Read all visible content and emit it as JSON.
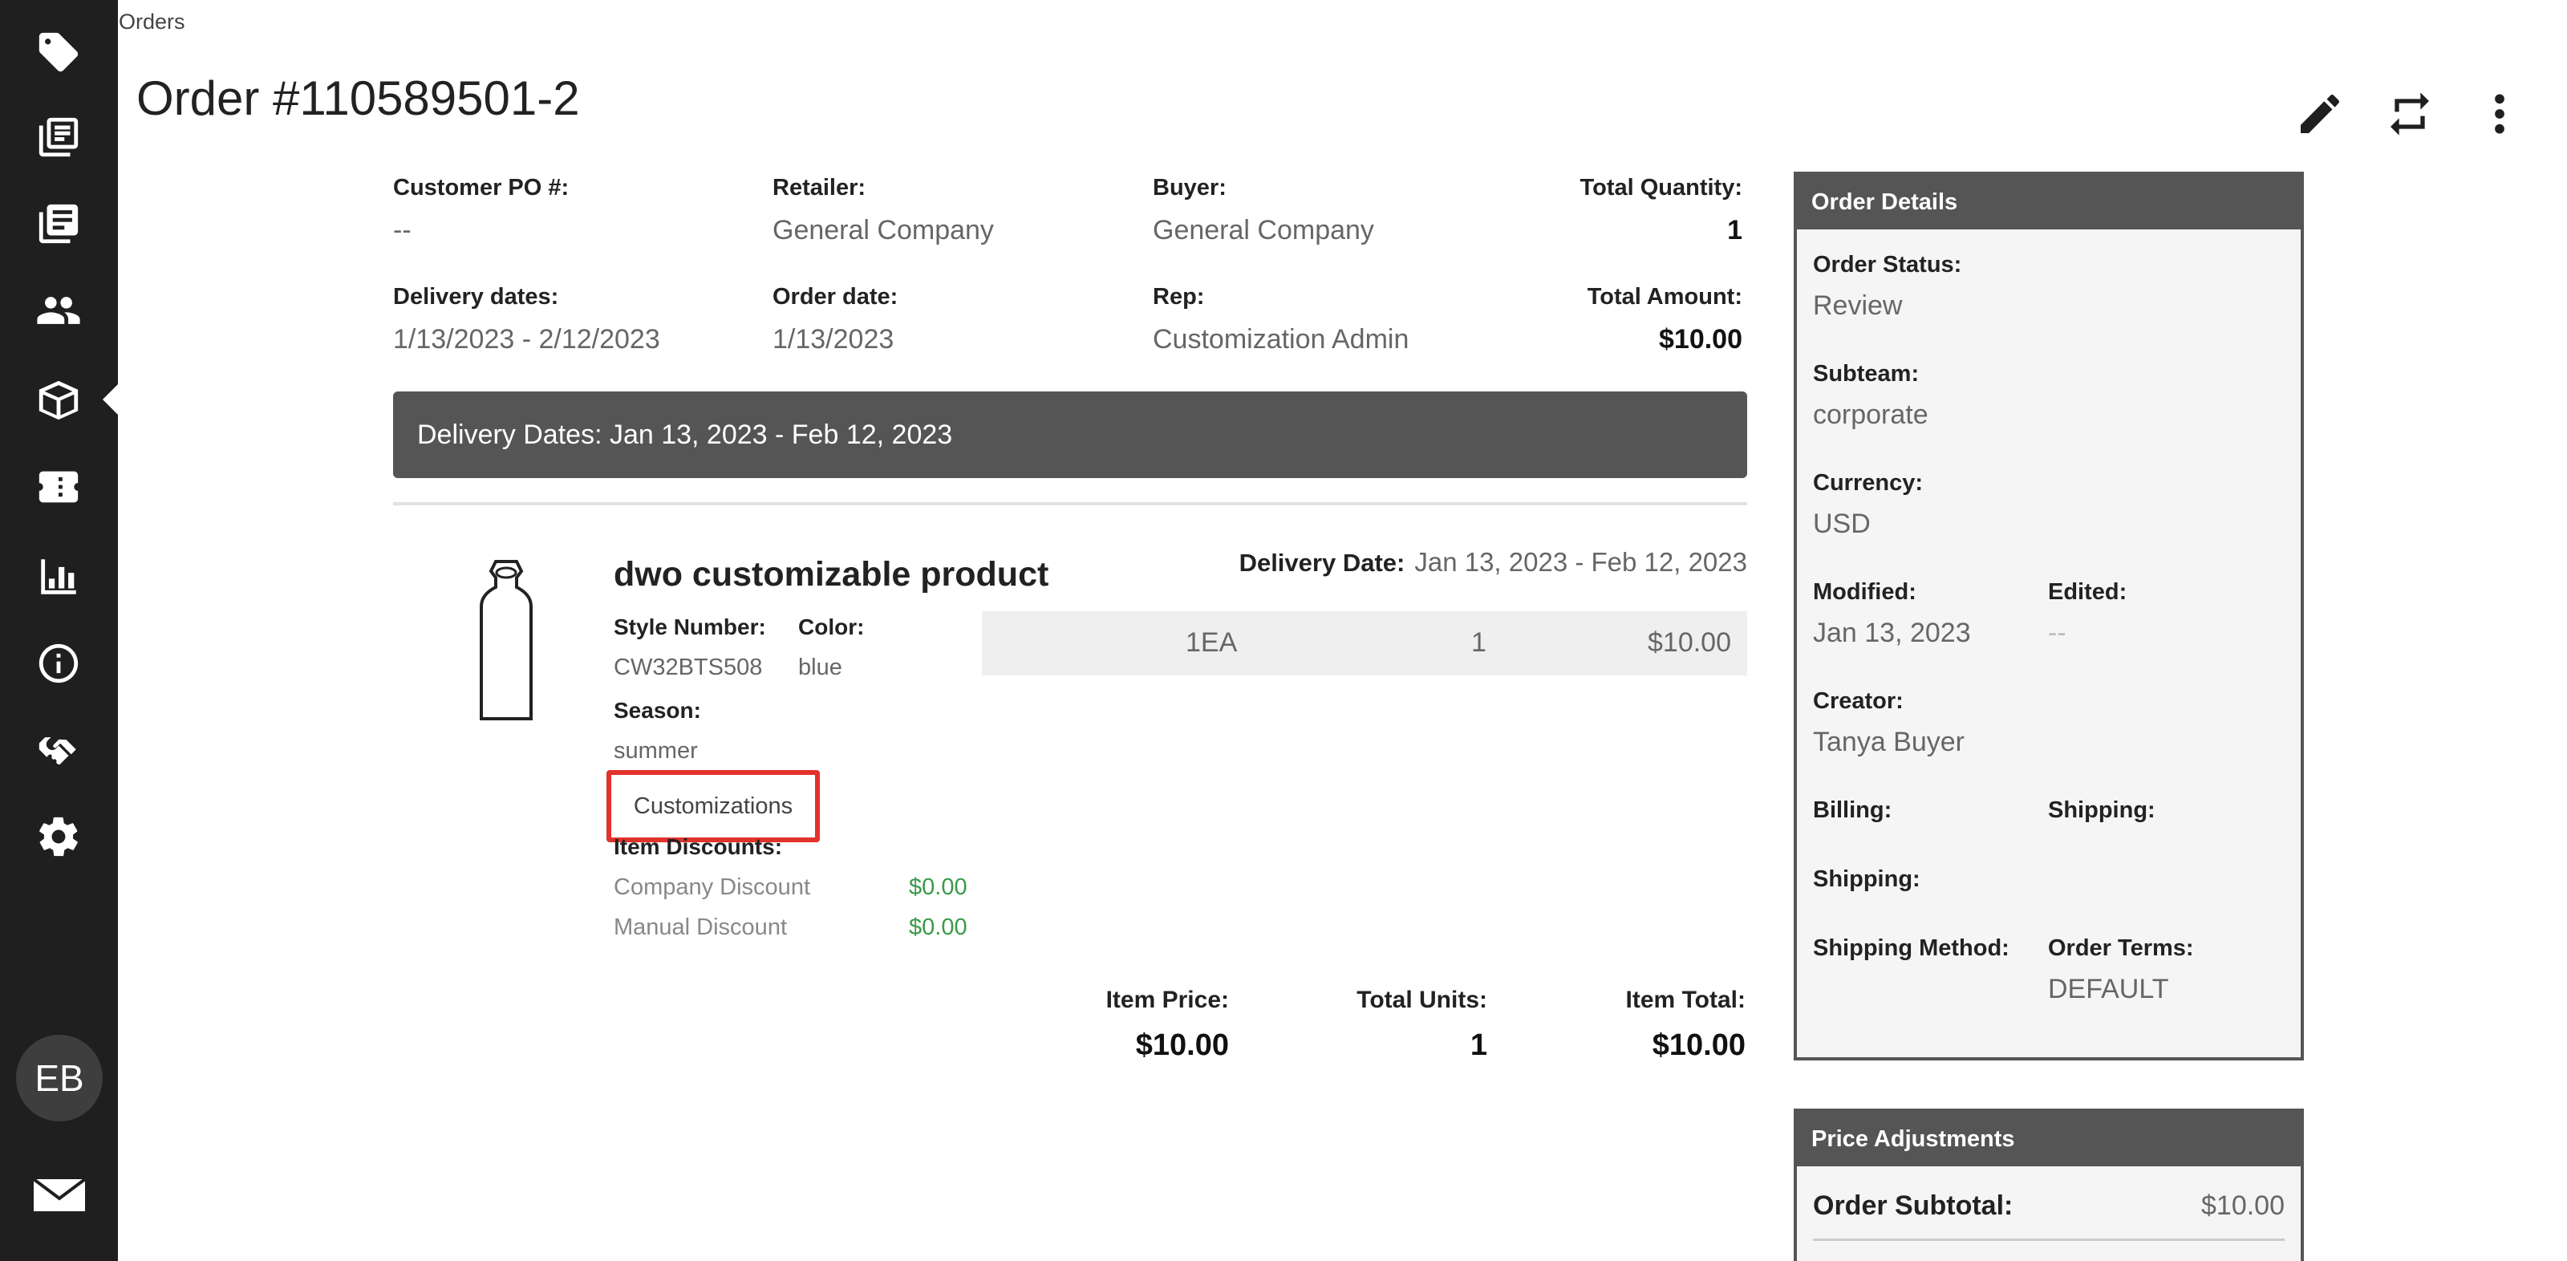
{
  "sidebar": {
    "items": [
      {
        "name": "tag",
        "icon": "tag-icon"
      },
      {
        "name": "catalog",
        "icon": "catalog-icon"
      },
      {
        "name": "linesheets",
        "icon": "linesheet-icon"
      },
      {
        "name": "customers",
        "icon": "users-icon"
      },
      {
        "name": "orders",
        "icon": "box-icon",
        "active": true
      },
      {
        "name": "promotions",
        "icon": "promotion-icon"
      },
      {
        "name": "reports",
        "icon": "chart-icon"
      },
      {
        "name": "info",
        "icon": "info-icon"
      },
      {
        "name": "partners",
        "icon": "handshake-icon"
      },
      {
        "name": "settings",
        "icon": "gear-icon"
      }
    ],
    "avatar_initials": "EB"
  },
  "header": {
    "breadcrumb": "Orders",
    "title": "Order #110589501-2"
  },
  "summary": {
    "customer_po_label": "Customer PO #:",
    "customer_po_value": "--",
    "retailer_label": "Retailer:",
    "retailer_value": "General Company",
    "buyer_label": "Buyer:",
    "buyer_value": "General Company",
    "total_qty_label": "Total Quantity:",
    "total_qty_value": "1",
    "delivery_dates_label": "Delivery dates:",
    "delivery_dates_value": "1/13/2023 - 2/12/2023",
    "order_date_label": "Order date:",
    "order_date_value": "1/13/2023",
    "rep_label": "Rep:",
    "rep_value": "Customization Admin",
    "total_amount_label": "Total Amount:",
    "total_amount_value": "$10.00"
  },
  "delivery_band": "Delivery Dates: Jan 13, 2023 - Feb 12, 2023",
  "item": {
    "name": "dwo customizable product",
    "style_label": "Style Number:",
    "style_value": "CW32BTS508",
    "color_label": "Color:",
    "color_value": "blue",
    "season_label": "Season:",
    "season_value": "summer",
    "delivery_label": "Delivery Date:",
    "delivery_value": "Jan 13, 2023 - Feb 12, 2023",
    "unit": "1EA",
    "qty": "1",
    "price": "$10.00",
    "customizations_button": "Customizations",
    "discounts_label": "Item Discounts:",
    "company_discount_label": "Company Discount",
    "company_discount_value": "$0.00",
    "manual_discount_label": "Manual Discount",
    "manual_discount_value": "$0.00",
    "item_price_label": "Item Price:",
    "item_price_value": "$10.00",
    "total_units_label": "Total Units:",
    "total_units_value": "1",
    "item_total_label": "Item Total:",
    "item_total_value": "$10.00"
  },
  "order_details": {
    "title": "Order Details",
    "status_label": "Order Status:",
    "status_value": "Review",
    "subteam_label": "Subteam:",
    "subteam_value": "corporate",
    "currency_label": "Currency:",
    "currency_value": "USD",
    "modified_label": "Modified:",
    "modified_value": "Jan 13, 2023",
    "edited_label": "Edited:",
    "edited_value": "--",
    "creator_label": "Creator:",
    "creator_value": "Tanya Buyer",
    "billing_label": "Billing:",
    "shipping_label": "Shipping:",
    "shipping2_label": "Shipping:",
    "shipping_method_label": "Shipping Method:",
    "order_terms_label": "Order Terms:",
    "order_terms_value": "DEFAULT"
  },
  "price_adjustments": {
    "title": "Price Adjustments",
    "subtotal_label": "Order Subtotal:",
    "subtotal_value": "$10.00"
  }
}
